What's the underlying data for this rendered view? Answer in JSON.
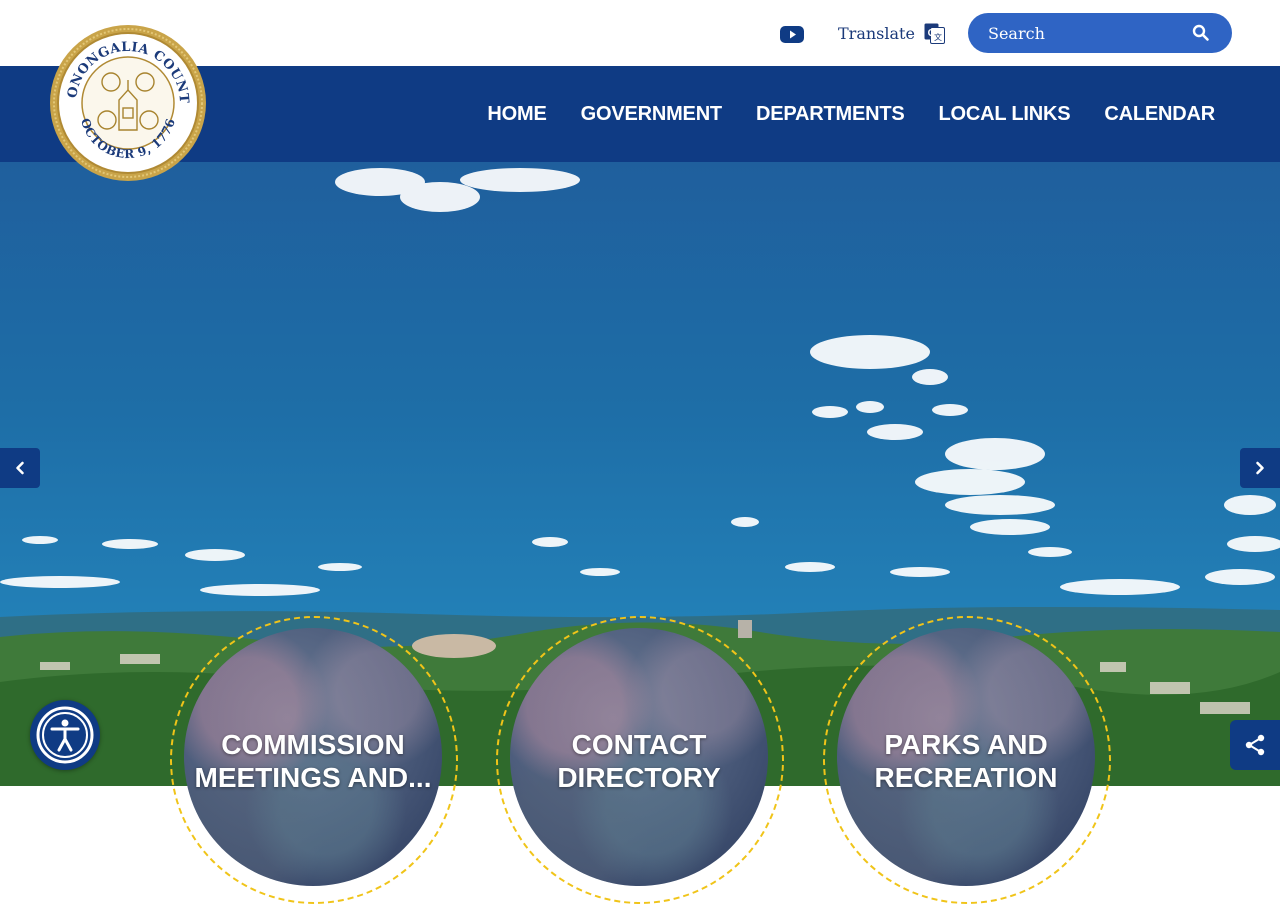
{
  "header": {
    "logo": {
      "ring_text_top": "MONONGALIA COUNTY",
      "ring_text_bottom": "OCTOBER 9, 1776"
    },
    "youtube_icon": "youtube-icon",
    "translate_label": "Translate",
    "translate_icon": "google-translate-icon",
    "search_placeholder": "Search",
    "search_icon": "search-icon"
  },
  "nav": {
    "items": [
      {
        "label": "HOME"
      },
      {
        "label": "GOVERNMENT"
      },
      {
        "label": "DEPARTMENTS"
      },
      {
        "label": "LOCAL LINKS"
      },
      {
        "label": "CALENDAR"
      }
    ]
  },
  "hero": {
    "prev_icon": "chevron-left-icon",
    "next_icon": "chevron-right-icon"
  },
  "quick_links": [
    {
      "label_line1": "COMMISSION",
      "label_line2": "MEETINGS AND..."
    },
    {
      "label_line1": "CONTACT",
      "label_line2": "DIRECTORY"
    },
    {
      "label_line1": "PARKS AND",
      "label_line2": "RECREATION"
    }
  ],
  "widgets": {
    "accessibility_icon": "accessibility-icon",
    "share_icon": "share-icon"
  },
  "colors": {
    "brand_navy": "#0f3b84",
    "search_blue": "#2f64c4",
    "accent_gold": "#f0c419",
    "sky_blue": "#1e6ea7"
  }
}
